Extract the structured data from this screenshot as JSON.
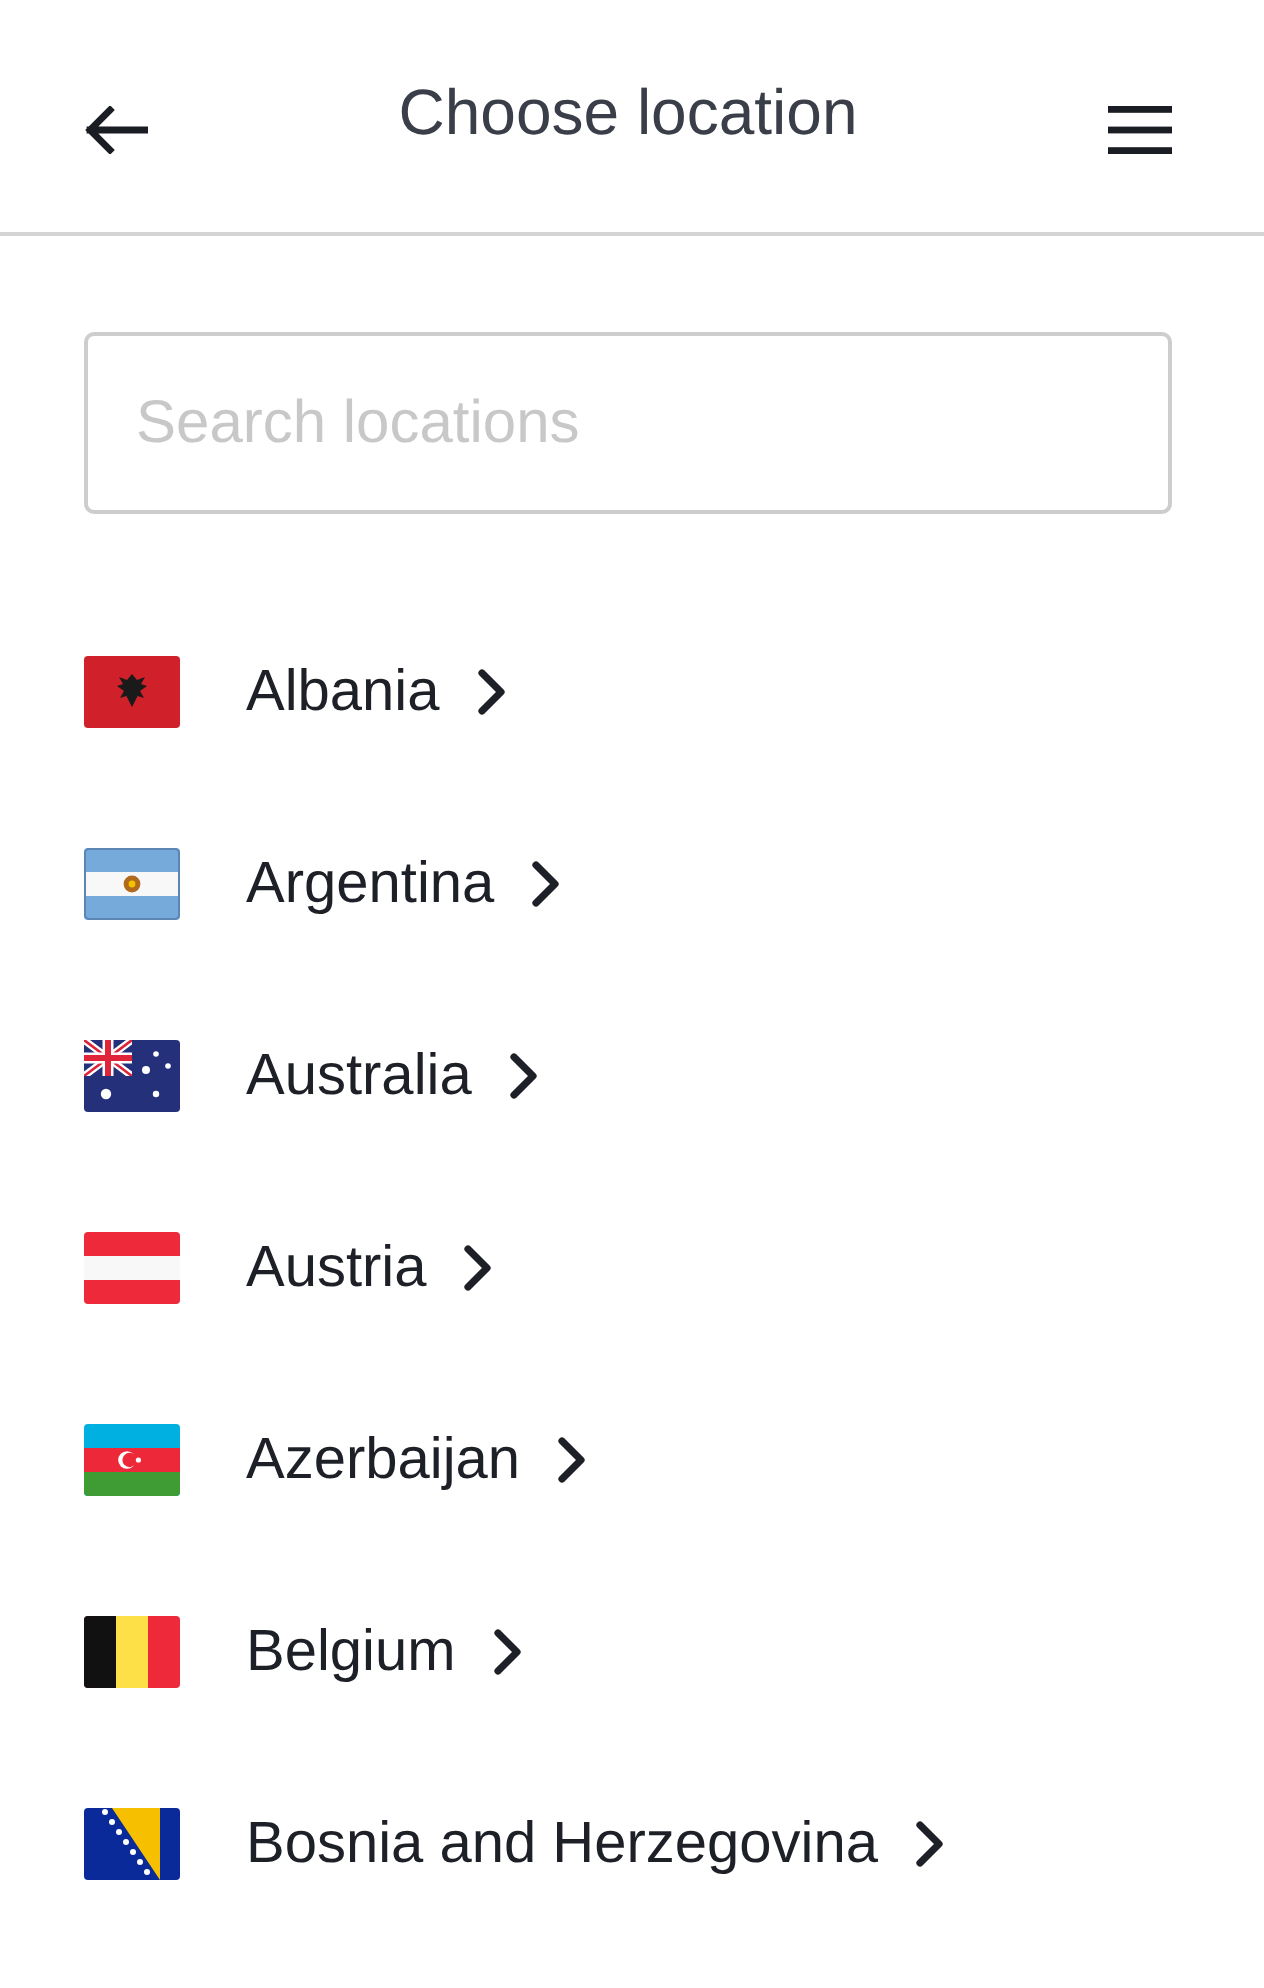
{
  "header": {
    "title": "Choose location"
  },
  "search": {
    "placeholder": "Search locations"
  },
  "locations": [
    {
      "name": "Albania"
    },
    {
      "name": "Argentina"
    },
    {
      "name": "Australia"
    },
    {
      "name": "Austria"
    },
    {
      "name": "Azerbaijan"
    },
    {
      "name": "Belgium"
    },
    {
      "name": "Bosnia and Herzegovina"
    }
  ]
}
